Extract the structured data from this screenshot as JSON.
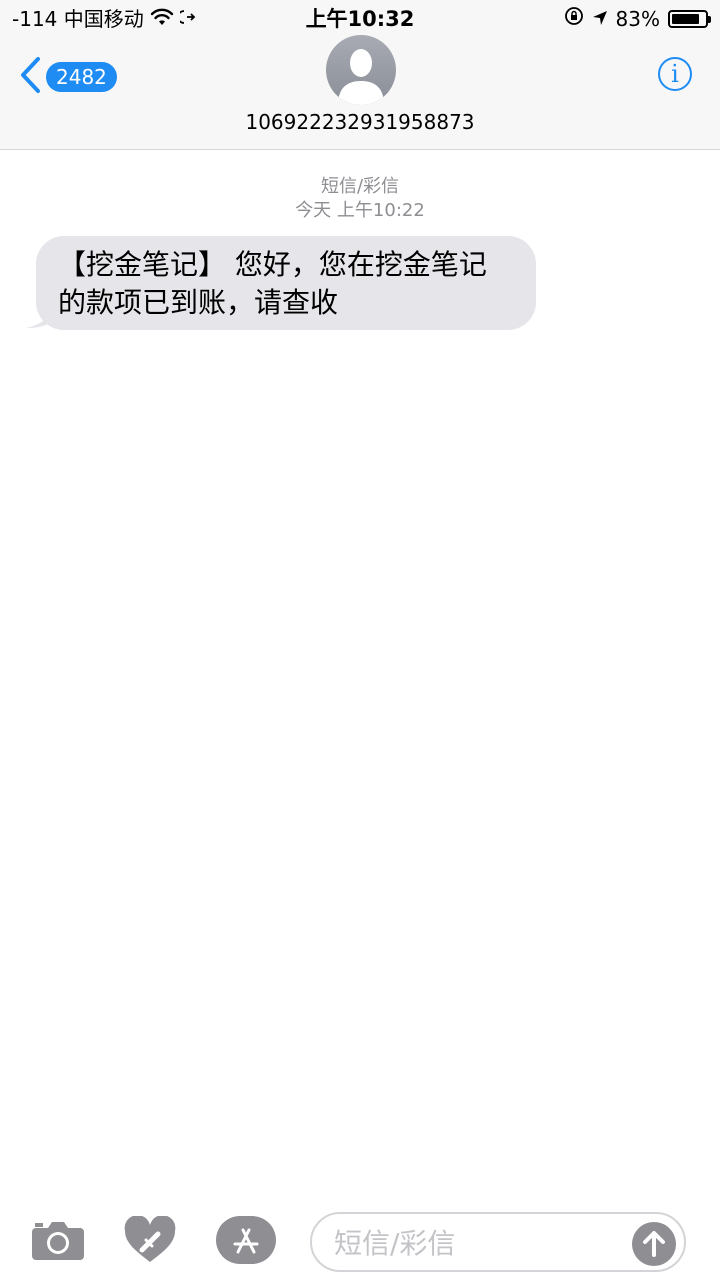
{
  "status_bar": {
    "carrier": "-114 中国移动",
    "time": "上午10:32",
    "battery": "83%",
    "battery_level": 0.83
  },
  "nav": {
    "back_count": "2482",
    "contact": "106922232931958873",
    "icons": {
      "back": "chevron-left-icon",
      "info": "info-icon",
      "avatar": "person-icon"
    }
  },
  "thread": {
    "message_type": "短信/彩信",
    "timestamp": "今天 上午10:22",
    "messages": [
      {
        "direction": "incoming",
        "line1": "【挖金笔记】 您好，您在挖金笔记",
        "line2": "的款项已到账，请查收"
      }
    ]
  },
  "composer": {
    "placeholder": "短信/彩信",
    "icons": [
      "camera-icon",
      "digital-touch-icon",
      "app-store-icon",
      "send-arrow-icon"
    ]
  },
  "colors": {
    "accent": "#1f8cf3",
    "bubble": "#e5e5ea",
    "meta": "#8e8e93"
  }
}
